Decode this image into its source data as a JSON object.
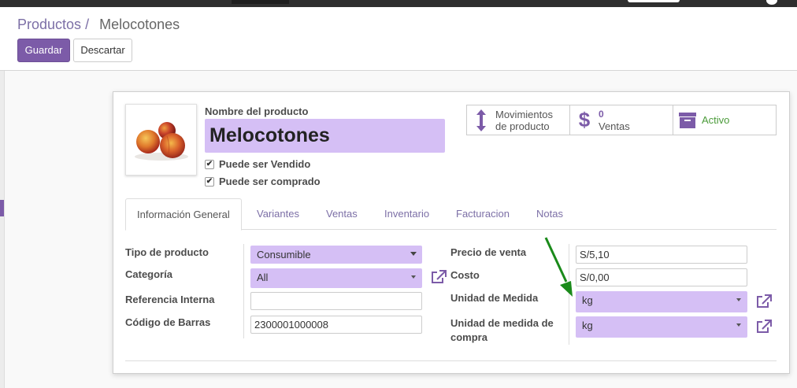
{
  "breadcrumb": {
    "parent": "Productos",
    "separator": "/",
    "current": "Melocotones"
  },
  "actions": {
    "save_label": "Guardar",
    "discard_label": "Descartar"
  },
  "product": {
    "name_label": "Nombre del producto",
    "name": "Melocotones",
    "can_be_sold_label": "Puede ser Vendido",
    "can_be_purchased_label": "Puede ser comprado",
    "can_be_sold": true,
    "can_be_purchased": true,
    "image_icon": "peaches-photo"
  },
  "smart_buttons": {
    "moves_line1": "Movimientos",
    "moves_line2": "de producto",
    "sales_count": "0",
    "sales_label": "Ventas",
    "active_label": "Activo"
  },
  "tabs": [
    {
      "label": "Información General"
    },
    {
      "label": "Variantes"
    },
    {
      "label": "Ventas"
    },
    {
      "label": "Inventario"
    },
    {
      "label": "Facturacion"
    },
    {
      "label": "Notas"
    }
  ],
  "general": {
    "type_label": "Tipo de producto",
    "type_value": "Consumible",
    "category_label": "Categoría",
    "category_value": "All",
    "internal_ref_label": "Referencia Interna",
    "internal_ref_value": "",
    "barcode_label": "Código de Barras",
    "barcode_value": "2300001000008",
    "sale_price_label": "Precio de venta",
    "sale_price_value": "S/5,10",
    "cost_label": "Costo",
    "cost_value": "S/0,00",
    "uom_label": "Unidad de Medida",
    "uom_value": "kg",
    "uom_po_label_1": "Unidad de medida de",
    "uom_po_label_2": "compra",
    "uom_po_value": "kg"
  },
  "colors": {
    "accent": "#7c5ba8",
    "required_field": "#d5bff5",
    "active_green": "#4b9b3a",
    "annotation_arrow": "#1a8a1a"
  }
}
